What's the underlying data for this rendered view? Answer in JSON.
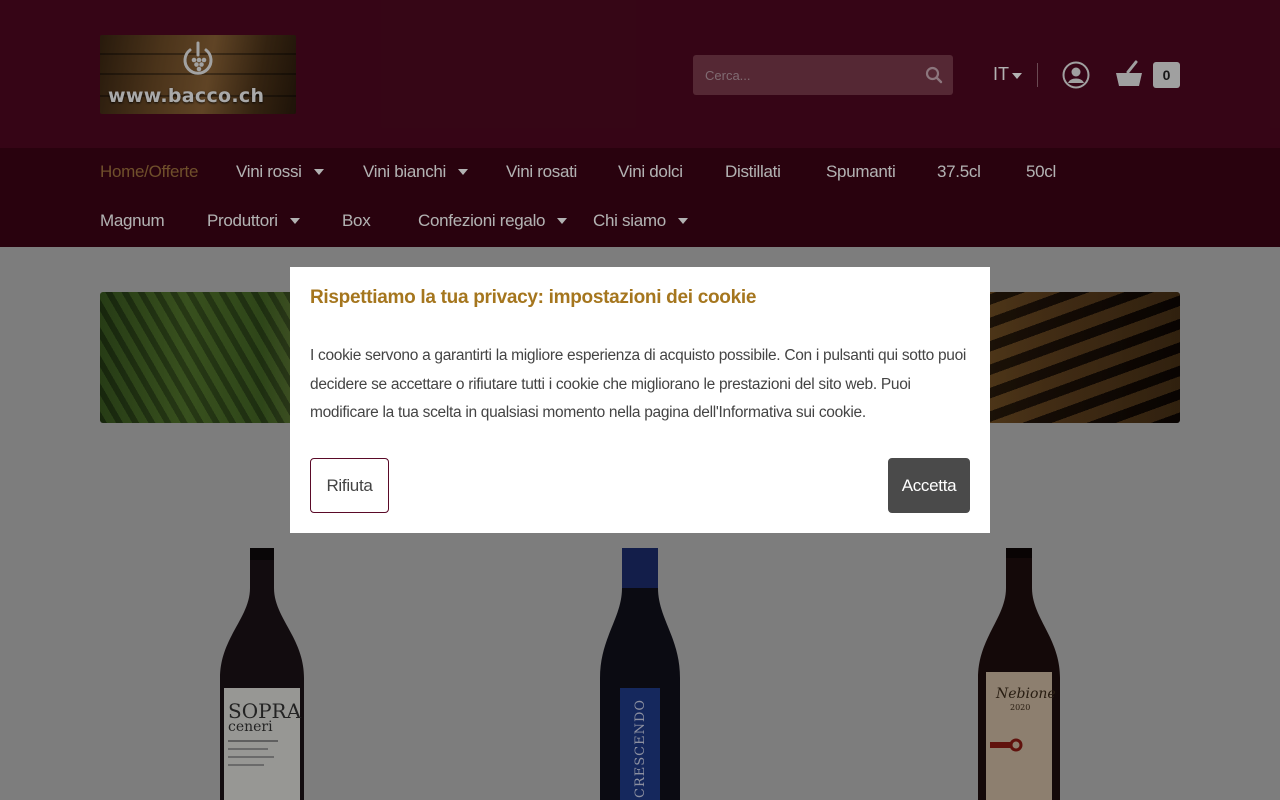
{
  "header": {
    "logo_text": "www.bacco.ch",
    "search_placeholder": "Cerca...",
    "language": "IT",
    "cart_count": "0"
  },
  "nav": {
    "row1": [
      {
        "label": "Home/Offerte",
        "active": true,
        "has_dropdown": false
      },
      {
        "label": "Vini rossi",
        "has_dropdown": true
      },
      {
        "label": "Vini bianchi",
        "has_dropdown": true
      },
      {
        "label": "Vini rosati",
        "has_dropdown": false
      },
      {
        "label": "Vini dolci",
        "has_dropdown": false
      },
      {
        "label": "Distillati",
        "has_dropdown": false
      },
      {
        "label": "Spumanti",
        "has_dropdown": false
      },
      {
        "label": "37.5cl",
        "has_dropdown": false
      },
      {
        "label": "50cl",
        "has_dropdown": false
      }
    ],
    "row2": [
      {
        "label": "Magnum",
        "has_dropdown": false
      },
      {
        "label": "Produttori",
        "has_dropdown": true
      },
      {
        "label": "Box",
        "has_dropdown": false
      },
      {
        "label": "Confezioni regalo",
        "has_dropdown": true
      },
      {
        "label": "Chi siamo",
        "has_dropdown": true
      }
    ]
  },
  "products": [
    {
      "label_line1": "SOPRA",
      "label_line2": "ceneri"
    },
    {
      "label_line1": "CRESCENDO"
    },
    {
      "label_line1": "Nebione",
      "label_line2": "2020"
    }
  ],
  "cookie_modal": {
    "title": "Rispettiamo la tua privacy: impostazioni dei cookie",
    "body": "I cookie servono a garantirti la migliore esperienza di acquisto possibile. Con i pulsanti qui sotto puoi decidere se accettare o rifiutare tutti i cookie che migliorano le prestazioni del sito web. Puoi modificare la tua scelta in qualsiasi momento nella pagina dell'Informativa sui cookie.",
    "reject_label": "Rifiuta",
    "accept_label": "Accetta"
  },
  "colors": {
    "header_bg": "#4e0820",
    "nav_bg": "#3b0415",
    "accent_gold": "#a5761e",
    "active_nav": "#a0723e",
    "accept_button": "#4a4a4a"
  }
}
